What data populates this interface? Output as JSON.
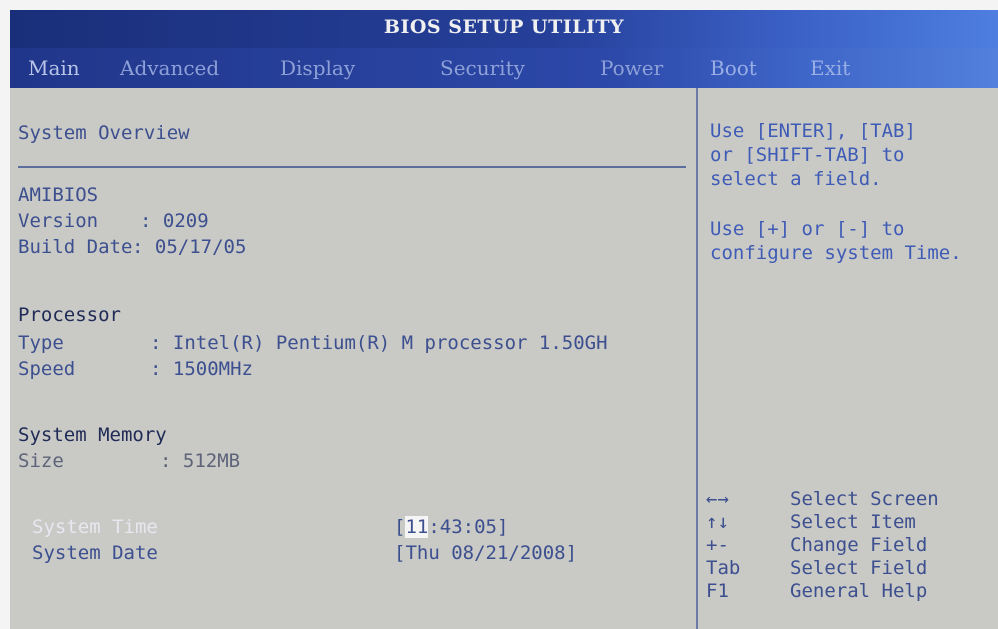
{
  "title": "BIOS SETUP UTILITY",
  "menu": [
    "Main",
    "Advanced",
    "Display",
    "Security",
    "Power",
    "Boot",
    "Exit"
  ],
  "left": {
    "section": "System Overview",
    "amibios": "AMIBIOS",
    "version_label": "Version",
    "version_value": ": 0209",
    "build_label": "Build Date",
    "build_value": ": 05/17/05",
    "processor_heading": "Processor",
    "type_label": "Type",
    "type_value": ": Intel(R) Pentium(R) M processor 1.50GH",
    "speed_label": "Speed",
    "speed_value": ": 1500MHz",
    "memory_heading": "System Memory",
    "size_label": "Size",
    "size_value": ": 512MB",
    "time_label": "System Time",
    "time_hour": "11",
    "time_rest": ":43:05]",
    "time_open": "[",
    "date_label": "System Date",
    "date_value": "[Thu 08/21/2008]"
  },
  "help": {
    "l1": "Use [ENTER], [TAB]",
    "l2": "or [SHIFT-TAB] to",
    "l3": "select a field.",
    "l4": "Use [+] or [-] to",
    "l5": "configure system Time."
  },
  "keys": [
    {
      "key": "←→",
      "desc": "Select Screen"
    },
    {
      "key": "↑↓",
      "desc": "Select Item"
    },
    {
      "key": "+-",
      "desc": "Change Field"
    },
    {
      "key": "Tab",
      "desc": "Select Field"
    },
    {
      "key": "F1",
      "desc": "General Help"
    }
  ],
  "colors": {
    "menu_bar": "#2c48a8",
    "panel": "#c9c9c6",
    "text": "#3c4f8e"
  }
}
